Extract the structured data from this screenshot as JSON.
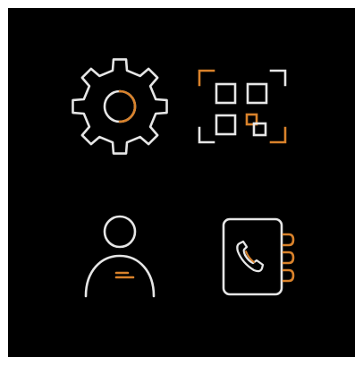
{
  "theme": {
    "background": "#000000",
    "frame": "#ffffff",
    "line": "#e6e6e6",
    "accent": "#d9822b"
  },
  "menu": {
    "items": [
      {
        "id": "settings",
        "icon": "gear-icon",
        "label": ""
      },
      {
        "id": "qr",
        "icon": "qr-scan-icon",
        "label": ""
      },
      {
        "id": "profile",
        "icon": "person-icon",
        "label": ""
      },
      {
        "id": "contacts",
        "icon": "phonebook-icon",
        "label": ""
      }
    ]
  }
}
